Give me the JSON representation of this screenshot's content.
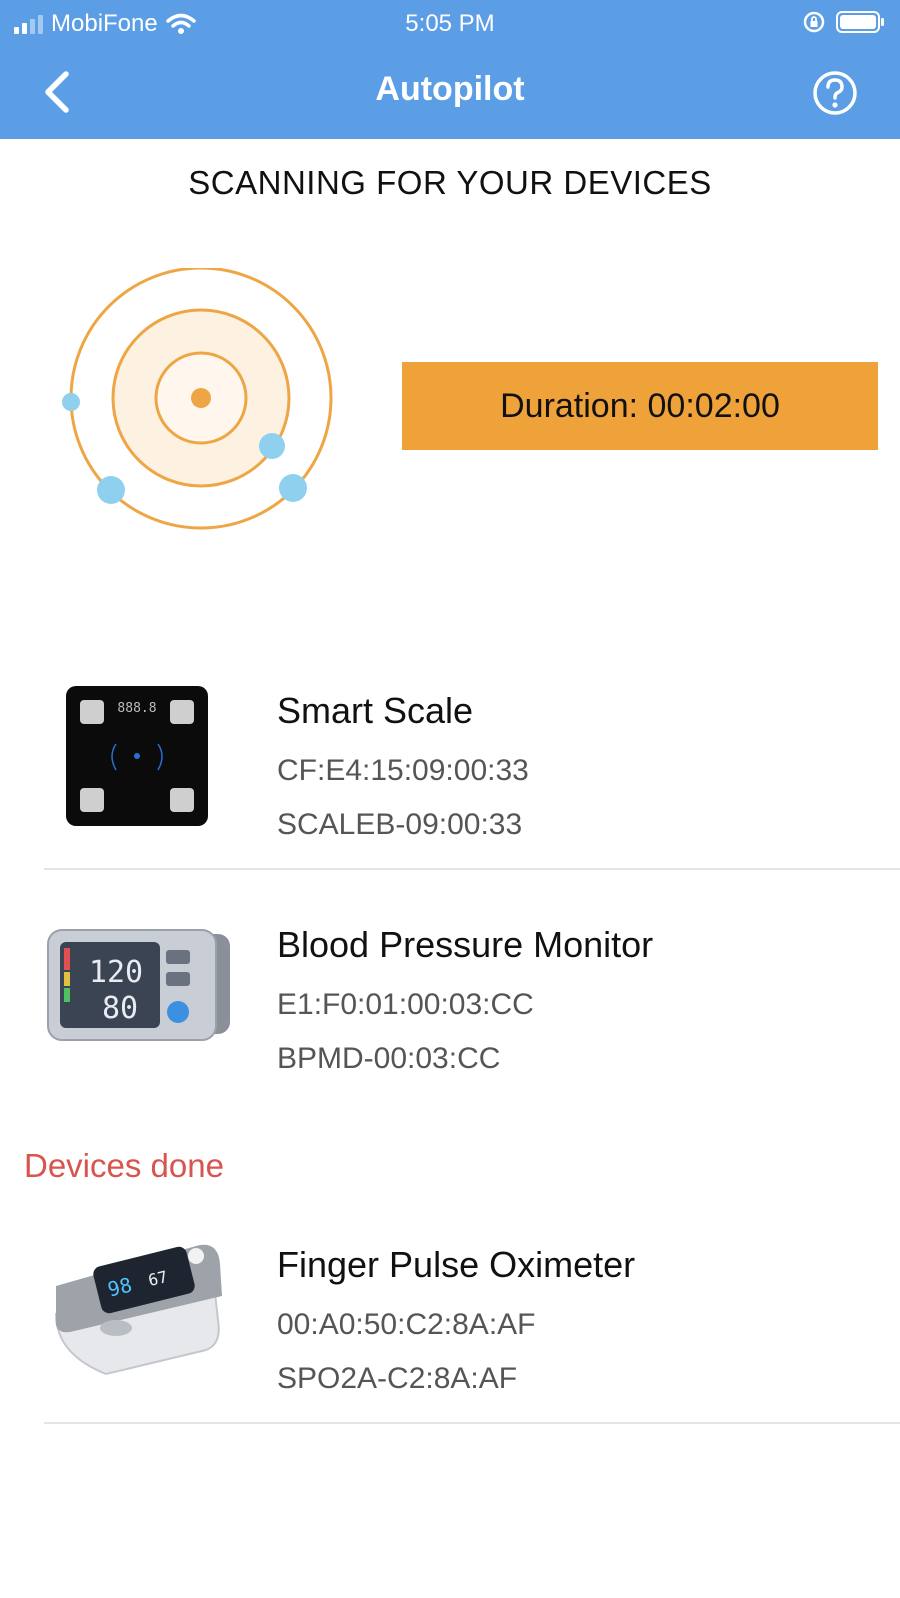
{
  "status_bar": {
    "carrier": "MobiFone",
    "time": "5:05 PM"
  },
  "nav": {
    "title": "Autopilot",
    "back_icon": "chevron-left-icon",
    "help_icon": "help-circle-icon"
  },
  "scan": {
    "title": "SCANNING FOR YOUR DEVICES",
    "duration": "Duration: 00:02:00"
  },
  "devices": [
    {
      "name": "Smart Scale",
      "mac": "CF:E4:15:09:00:33",
      "code": "SCALEB-09:00:33",
      "icon": "smart-scale-image"
    },
    {
      "name": "Blood Pressure Monitor",
      "mac": "E1:F0:01:00:03:CC",
      "code": "BPMD-00:03:CC",
      "icon": "blood-pressure-monitor-image"
    }
  ],
  "done_section": {
    "label": "Devices done",
    "devices": [
      {
        "name": "Finger Pulse Oximeter",
        "mac": "00:A0:50:C2:8A:AF",
        "code": "SPO2A-C2:8A:AF",
        "icon": "pulse-oximeter-image"
      }
    ]
  },
  "colors": {
    "header": "#5b9ee6",
    "accent": "#f0a23a",
    "radar_dot": "#8fd0ee",
    "done_label": "#d9534f"
  },
  "bp_display": {
    "sys": "120",
    "dia": "80"
  },
  "oxi_display": {
    "spo2": "98",
    "pulse": "67"
  },
  "scale_display": "888.8"
}
